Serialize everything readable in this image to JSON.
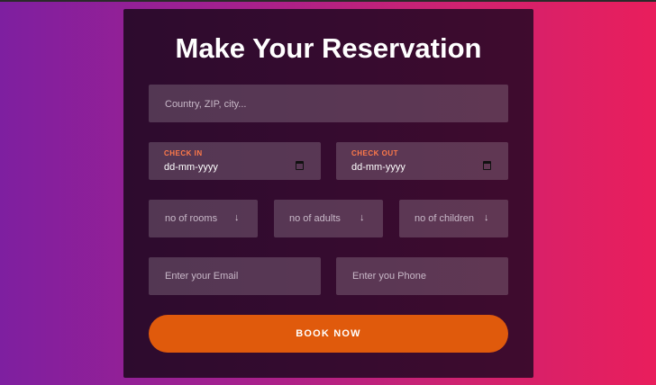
{
  "form": {
    "title": "Make Your Reservation",
    "location_placeholder": "Country, ZIP, city...",
    "check_in": {
      "label": "CHECK IN",
      "value": "dd-mm-yyyy"
    },
    "check_out": {
      "label": "CHECK OUT",
      "value": "dd-mm-yyyy"
    },
    "rooms_placeholder": "no of rooms",
    "adults_placeholder": "no of adults",
    "children_placeholder": "no of children",
    "email_placeholder": "Enter your Email",
    "phone_placeholder": "Enter you Phone",
    "book_label": "BOOK NOW",
    "select_icon": "arrow-down-icon",
    "calendar_icon": "calendar-icon",
    "accent_color": "#e05a0c",
    "label_color": "#ff7a4a"
  }
}
